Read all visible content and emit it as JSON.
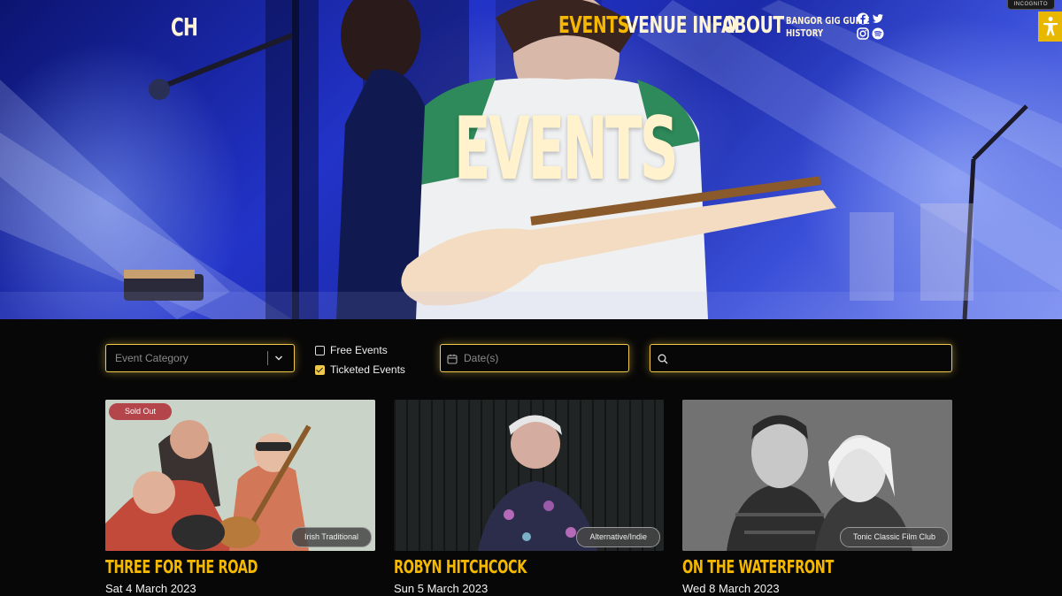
{
  "brand": {
    "logo_text": "CH"
  },
  "nav": {
    "links": [
      "EVENTS",
      "VENUE INFO",
      "ABOUT"
    ],
    "small_links": [
      "BANGOR GIG GUIDE",
      "HISTORY"
    ],
    "social_icons": [
      "facebook-icon",
      "twitter-icon",
      "instagram-icon",
      "spotify-icon"
    ]
  },
  "hero": {
    "title": "EVENTS"
  },
  "browser": {
    "incognito_label": "INCOGNITO"
  },
  "filters": {
    "category_placeholder": "Event Category",
    "free_events_label": "Free Events",
    "ticketed_events_label": "Ticketed Events",
    "free_events_checked": false,
    "ticketed_events_checked": true,
    "date_placeholder": "Date(s)",
    "search_placeholder": ""
  },
  "events": [
    {
      "title": "THREE FOR THE ROAD",
      "date": "Sat 4 March 2023",
      "category": "Irish Traditional",
      "badge": "Sold Out"
    },
    {
      "title": "ROBYN HITCHCOCK",
      "date": "Sun 5 March 2023",
      "category": "Alternative/Indie",
      "badge": ""
    },
    {
      "title": "ON THE WATERFRONT",
      "date": "Wed 8 March 2023",
      "category": "Tonic Classic Film Club",
      "badge": ""
    }
  ],
  "colors": {
    "accent": "#f5b800",
    "field_border": "#f0c94a",
    "sold_out": "#b4454a",
    "background": "#070707",
    "cream": "#fff5d6"
  }
}
